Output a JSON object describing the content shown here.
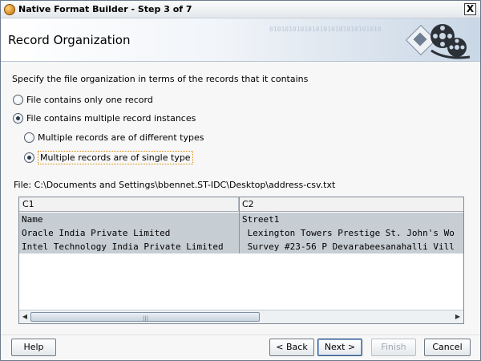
{
  "window": {
    "title": "Native Format Builder - Step 3 of 7",
    "close_label": "X"
  },
  "header": {
    "title": "Record Organization",
    "banner_binary": "01010101010101010101010101010"
  },
  "main": {
    "description": "Specify the file organization in terms of the records that it contains",
    "options": [
      {
        "label": "File contains only one record",
        "checked": false
      },
      {
        "label": "File contains multiple record instances",
        "checked": true
      }
    ],
    "sub_options": [
      {
        "label": "Multiple records are of different types",
        "checked": false
      },
      {
        "label": "Multiple records are of single type",
        "checked": true
      }
    ],
    "file_path": "File: C:\\Documents and Settings\\bbennet.ST-IDC\\Desktop\\address-csv.txt"
  },
  "grid": {
    "columns": [
      "C1",
      "C2"
    ],
    "rows": [
      [
        "Name",
        "Street1"
      ],
      [
        "Oracle India Private Limited",
        " Lexington Towers Prestige St. John's Wo"
      ],
      [
        "Intel Technology India Private Limited",
        " Survey #23-56 P Devarabeesanahalli Vill"
      ]
    ],
    "scroll_grip": "|||"
  },
  "footer": {
    "help": "Help",
    "back": "< Back",
    "next": "Next >",
    "finish": "Finish",
    "cancel": "Cancel"
  },
  "colors": {
    "selection_background": "#c6cdd3",
    "focus_outline": "#d88a00"
  },
  "icons": {
    "app": "app-gear-icon",
    "banner": "film-reel-icon",
    "scroll_left": "arrow-left-icon",
    "scroll_right": "arrow-right-icon"
  }
}
